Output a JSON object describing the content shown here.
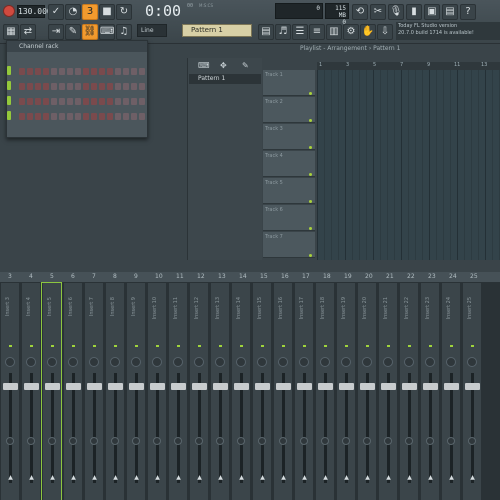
{
  "toolbar": {
    "bpm": "130.000",
    "time": "0:00",
    "time_small": "00",
    "time_mode": "M:S:CS",
    "cpu": "0",
    "mem": "115 MB",
    "mem_sub": "0",
    "snap": "Line",
    "pattern": "Pattern 1",
    "hint_title": "Today  FL Studio version",
    "hint_text": "20.7.0 build 1714 is available!"
  },
  "channel_rack": {
    "title": "Channel rack"
  },
  "pattern_panel": {
    "selected": "Pattern 1"
  },
  "playlist": {
    "title": "Playlist - Arrangement › Pattern 1",
    "ruler": [
      "1",
      "3",
      "5",
      "7",
      "9",
      "11",
      "13"
    ],
    "tracks": [
      "Track 1",
      "Track 2",
      "Track 3",
      "Track 4",
      "Track 5",
      "Track 6",
      "Track 7"
    ]
  },
  "mixer": {
    "ruler": [
      "3",
      "4",
      "5",
      "6",
      "7",
      "8",
      "9",
      "10",
      "11",
      "12",
      "13",
      "14",
      "15",
      "16",
      "17",
      "18",
      "19",
      "20",
      "21",
      "22",
      "23",
      "24",
      "25"
    ],
    "strips": [
      "Insert 3",
      "Insert 4",
      "Insert 5",
      "Insert 6",
      "Insert 7",
      "Insert 8",
      "Insert 9",
      "Insert 10",
      "Insert 11",
      "Insert 12",
      "Insert 13",
      "Insert 14",
      "Insert 15",
      "Insert 16",
      "Insert 17",
      "Insert 18",
      "Insert 19",
      "Insert 20",
      "Insert 21",
      "Insert 22",
      "Insert 23",
      "Insert 24",
      "Insert 25"
    ]
  },
  "colors": {
    "accent": "#f29a2e",
    "led": "#94c93b",
    "pattern_bg": "#d8d0a6"
  }
}
